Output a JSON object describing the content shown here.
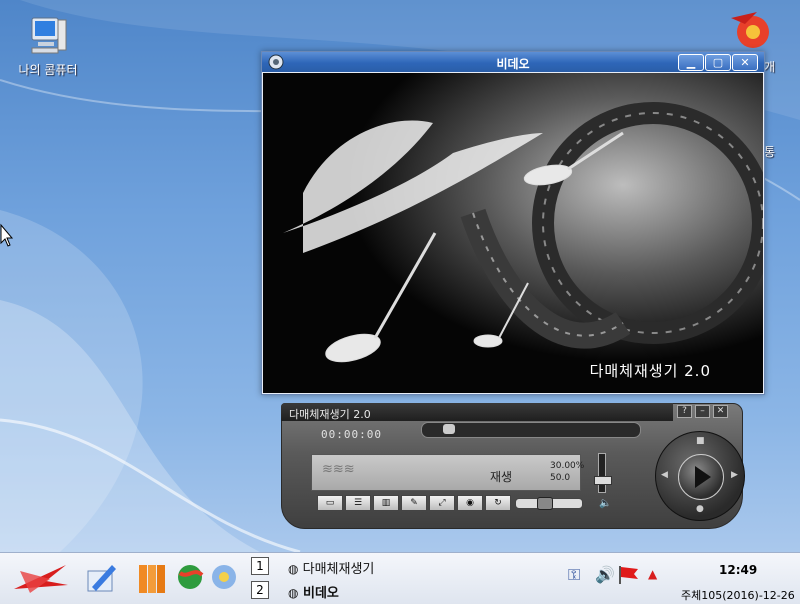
{
  "desktop": {
    "icons": [
      {
        "label": "나의 콤퓨터",
        "icon": "computer-icon"
      }
    ],
    "edge_labels": [
      "개",
      "통"
    ]
  },
  "video_window": {
    "title": "비데오",
    "splash_text": "다매체재생기 2.0",
    "buttons": [
      "minimize",
      "maximize",
      "close"
    ]
  },
  "player": {
    "title": "다매체재생기 2.0",
    "time": "00:00:00",
    "screen": {
      "mode": "재생",
      "readout_1": "30.00%",
      "readout_2": "50.0"
    },
    "seek_position": 0.1,
    "volume_level": 0.4,
    "controls": [
      "open-icon",
      "playlist-icon",
      "equalizer-icon",
      "settings-icon",
      "fullscreen-icon",
      "snapshot-icon",
      "repeat-icon"
    ]
  },
  "taskbar": {
    "tasks": [
      {
        "num": "1",
        "label": "다매체재생기"
      },
      {
        "num": "2",
        "label": "비데오"
      }
    ],
    "clock": "12:49",
    "date": "주체105(2016)-12-26"
  },
  "colors": {
    "titlebar": "#2e66b8",
    "desktop": "#6fa1dc",
    "player_body": "#5a5a5a"
  }
}
